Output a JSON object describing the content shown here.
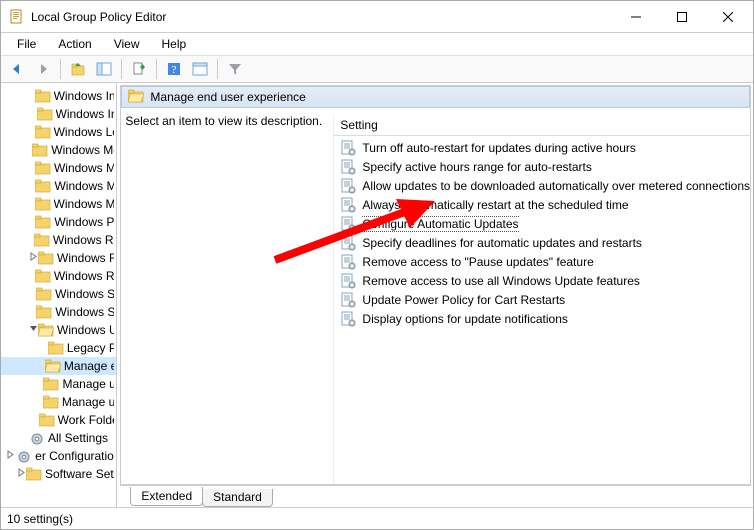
{
  "window": {
    "title": "Local Group Policy Editor"
  },
  "menu": {
    "items": [
      "File",
      "Action",
      "View",
      "Help"
    ]
  },
  "tree": {
    "items": [
      {
        "indent": 1,
        "twisty": "",
        "label": "Windows Ink Workspace"
      },
      {
        "indent": 1,
        "twisty": "",
        "label": "Windows Installer"
      },
      {
        "indent": 1,
        "twisty": "",
        "label": "Windows Logon Options"
      },
      {
        "indent": 1,
        "twisty": "",
        "label": "Windows Media Digital Rights Management"
      },
      {
        "indent": 1,
        "twisty": "",
        "label": "Windows Media Player"
      },
      {
        "indent": 1,
        "twisty": "",
        "label": "Windows Messenger"
      },
      {
        "indent": 1,
        "twisty": "",
        "label": "Windows Mobility Center"
      },
      {
        "indent": 1,
        "twisty": "",
        "label": "Windows PowerShell"
      },
      {
        "indent": 1,
        "twisty": "",
        "label": "Windows Reliability Analysis"
      },
      {
        "indent": 1,
        "twisty": ">",
        "label": "Windows Remote Management (WinRM)"
      },
      {
        "indent": 1,
        "twisty": "",
        "label": "Windows Remote Shell"
      },
      {
        "indent": 1,
        "twisty": "",
        "label": "Windows Sandbox"
      },
      {
        "indent": 1,
        "twisty": "",
        "label": "Windows Security"
      },
      {
        "indent": 1,
        "twisty": "v",
        "label": "Windows Update",
        "open": true
      },
      {
        "indent": 2,
        "twisty": "",
        "label": "Legacy Policies"
      },
      {
        "indent": 2,
        "twisty": "",
        "label": "Manage end user experience",
        "selected": true,
        "open": true
      },
      {
        "indent": 2,
        "twisty": "",
        "label": "Manage updates offered from Windows Update"
      },
      {
        "indent": 2,
        "twisty": "",
        "label": "Manage updates offered from Windows Server Update Service"
      },
      {
        "indent": 1,
        "twisty": "",
        "label": "Work Folders"
      },
      {
        "indent": 0,
        "twisty": "",
        "label": "All Settings",
        "kind": "gear"
      },
      {
        "indent": -1,
        "twisty": ">",
        "label": "er Configuration",
        "kind": "gear"
      },
      {
        "indent": 0,
        "twisty": ">",
        "label": "Software Settings"
      }
    ]
  },
  "right": {
    "header": "Manage end user experience",
    "desc_hint": "Select an item to view its description.",
    "column_header": "Setting",
    "settings": [
      "Turn off auto-restart for updates during active hours",
      "Specify active hours range for auto-restarts",
      "Allow updates to be downloaded automatically over metered connections",
      "Always automatically restart at the scheduled time",
      "Configure Automatic Updates",
      "Specify deadlines for automatic updates and restarts",
      "Remove access to \"Pause updates\" feature",
      "Remove access to use all Windows Update features",
      "Update Power Policy for Cart Restarts",
      "Display options for update notifications"
    ],
    "highlight_index": 4,
    "tabs": [
      "Extended",
      "Standard"
    ],
    "active_tab": 0
  },
  "status": {
    "text": "10 setting(s)"
  },
  "arrow": {
    "color": "#ff0000"
  }
}
